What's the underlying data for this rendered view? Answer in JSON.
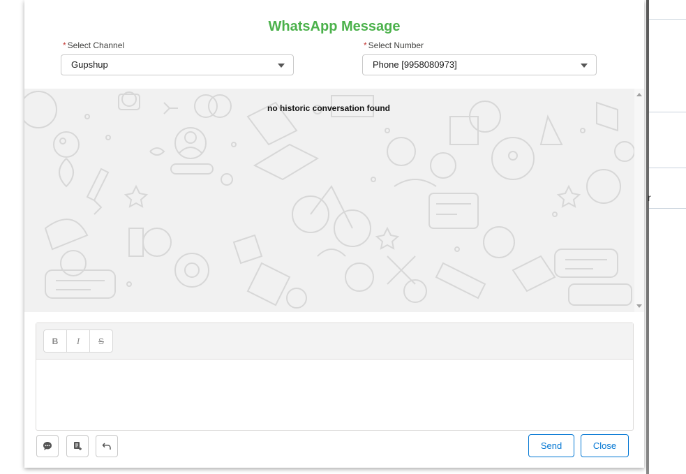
{
  "modal": {
    "title": "WhatsApp Message"
  },
  "channel": {
    "label": "Select Channel",
    "required_mark": "*",
    "value": "Gupshup"
  },
  "number": {
    "label": "Select Number",
    "required_mark": "*",
    "value": "Phone [9958080973]"
  },
  "conversation": {
    "empty_text": "no historic conversation found"
  },
  "toolbar": {
    "bold": "B",
    "italic": "I",
    "strike": "S"
  },
  "actions": {
    "send": "Send",
    "close": "Close"
  },
  "icons": [
    "chat-icon",
    "note-add-icon",
    "undo-icon",
    "caret-down-icon"
  ],
  "colors": {
    "title": "#4bb14b",
    "required": "#c23934",
    "button": "#0176d3"
  },
  "background_edge": {
    "char": "r"
  }
}
